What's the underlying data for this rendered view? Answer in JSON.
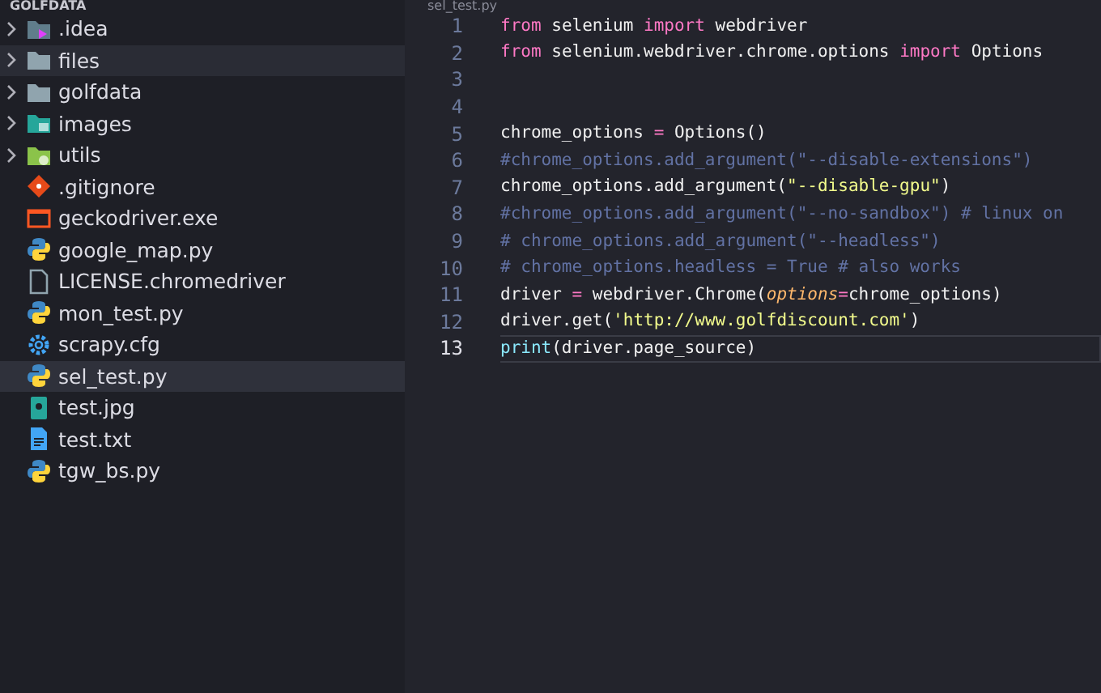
{
  "explorer": {
    "title": "GOLFDATA",
    "items": [
      {
        "name": ".idea",
        "kind": "folder-idea",
        "expandable": true,
        "hovered": false,
        "selected": false
      },
      {
        "name": "files",
        "kind": "folder",
        "expandable": true,
        "hovered": true,
        "selected": false
      },
      {
        "name": "golfdata",
        "kind": "folder",
        "expandable": true,
        "hovered": false,
        "selected": false
      },
      {
        "name": "images",
        "kind": "folder-images",
        "expandable": true,
        "hovered": false,
        "selected": false
      },
      {
        "name": "utils",
        "kind": "folder-utils",
        "expandable": true,
        "hovered": false,
        "selected": false
      },
      {
        "name": ".gitignore",
        "kind": "git",
        "expandable": false,
        "hovered": false,
        "selected": false
      },
      {
        "name": "geckodriver.exe",
        "kind": "exe",
        "expandable": false,
        "hovered": false,
        "selected": false
      },
      {
        "name": "google_map.py",
        "kind": "python",
        "expandable": false,
        "hovered": false,
        "selected": false
      },
      {
        "name": "LICENSE.chromedriver",
        "kind": "file",
        "expandable": false,
        "hovered": false,
        "selected": false
      },
      {
        "name": "mon_test.py",
        "kind": "python",
        "expandable": false,
        "hovered": false,
        "selected": false
      },
      {
        "name": "scrapy.cfg",
        "kind": "config",
        "expandable": false,
        "hovered": false,
        "selected": false
      },
      {
        "name": "sel_test.py",
        "kind": "python",
        "expandable": false,
        "hovered": false,
        "selected": true
      },
      {
        "name": "test.jpg",
        "kind": "image",
        "expandable": false,
        "hovered": false,
        "selected": false
      },
      {
        "name": "test.txt",
        "kind": "text",
        "expandable": false,
        "hovered": false,
        "selected": false
      },
      {
        "name": "tgw_bs.py",
        "kind": "python",
        "expandable": false,
        "hovered": false,
        "selected": false
      }
    ]
  },
  "editor": {
    "tab": "sel_test.py",
    "lines": [
      {
        "number": "1",
        "current": false,
        "tokens": [
          {
            "kind": "keyword",
            "text": "from"
          },
          {
            "kind": "plain",
            "text": " selenium "
          },
          {
            "kind": "keyword",
            "text": "import"
          },
          {
            "kind": "plain",
            "text": " webdriver"
          }
        ]
      },
      {
        "number": "2",
        "current": false,
        "tokens": [
          {
            "kind": "keyword",
            "text": "from"
          },
          {
            "kind": "plain",
            "text": " selenium.webdriver.chrome.options "
          },
          {
            "kind": "keyword",
            "text": "import"
          },
          {
            "kind": "plain",
            "text": " Options"
          }
        ]
      },
      {
        "number": "3",
        "current": false
      },
      {
        "number": "4",
        "current": false
      },
      {
        "number": "5",
        "current": false,
        "tokens": [
          {
            "kind": "plain",
            "text": "chrome_options "
          },
          {
            "kind": "operator",
            "text": "="
          },
          {
            "kind": "plain",
            "text": " Options()"
          }
        ]
      },
      {
        "number": "6",
        "current": false,
        "tokens": [
          {
            "kind": "comment",
            "text": "#chrome_options.add_argument(\"--disable-extensions\")"
          }
        ]
      },
      {
        "number": "7",
        "current": false,
        "tokens": [
          {
            "kind": "plain",
            "text": "chrome_options.add_argument("
          },
          {
            "kind": "string",
            "text": "\"--disable-gpu\""
          },
          {
            "kind": "plain",
            "text": ")"
          }
        ]
      },
      {
        "number": "8",
        "current": false,
        "tokens": [
          {
            "kind": "comment",
            "text": "#chrome_options.add_argument(\"--no-sandbox\") # linux on"
          }
        ]
      },
      {
        "number": "9",
        "current": false,
        "tokens": [
          {
            "kind": "comment",
            "text": "# chrome_options.add_argument(\"--headless\")"
          }
        ]
      },
      {
        "number": "10",
        "current": false,
        "tokens": [
          {
            "kind": "comment",
            "text": "# chrome_options.headless = True # also works"
          }
        ]
      },
      {
        "number": "11",
        "current": false,
        "tokens": [
          {
            "kind": "plain",
            "text": "driver "
          },
          {
            "kind": "operator",
            "text": "="
          },
          {
            "kind": "plain",
            "text": " webdriver.Chrome("
          },
          {
            "kind": "param",
            "text": "options"
          },
          {
            "kind": "operator",
            "text": "="
          },
          {
            "kind": "plain",
            "text": "chrome_options)"
          }
        ]
      },
      {
        "number": "12",
        "current": false,
        "tokens": [
          {
            "kind": "plain",
            "text": "driver.get("
          },
          {
            "kind": "string",
            "text": "'http://www.golfdiscount.com'"
          },
          {
            "kind": "plain",
            "text": ")"
          }
        ]
      },
      {
        "number": "13",
        "current": true,
        "tokens": [
          {
            "kind": "builtin",
            "text": "print"
          },
          {
            "kind": "plain",
            "text": "(driver.page_source)"
          }
        ]
      }
    ]
  }
}
